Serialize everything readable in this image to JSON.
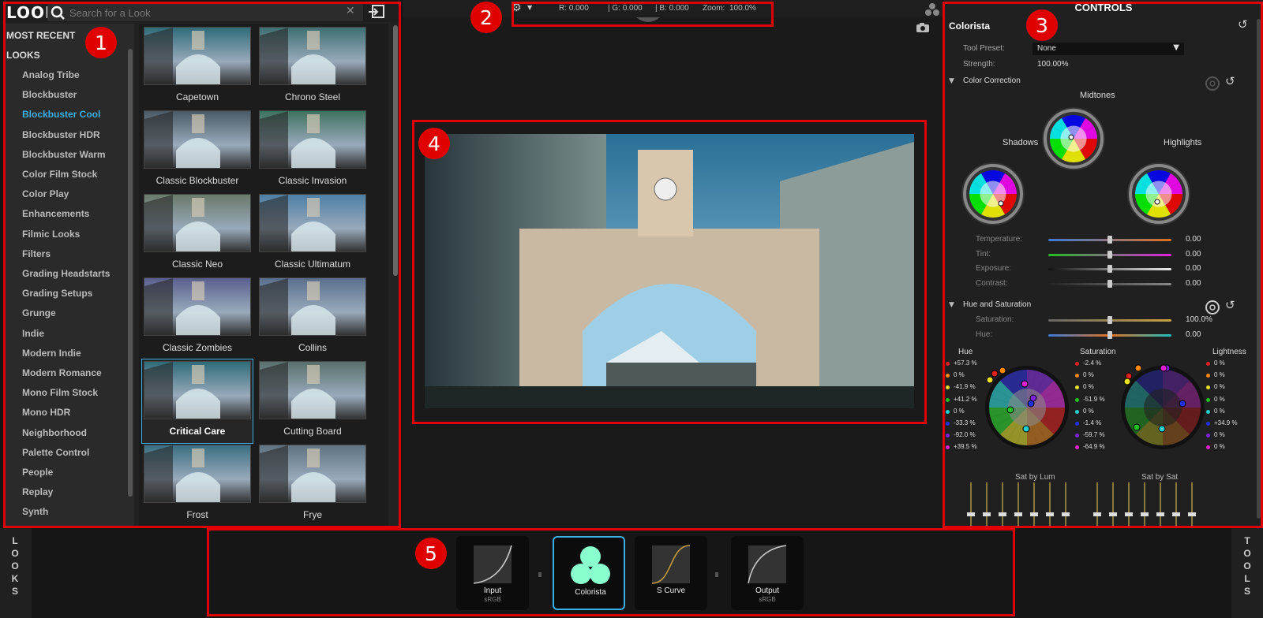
{
  "looks_panel": {
    "logo": "LOOKS",
    "search_placeholder": "Search for a Look",
    "most_recent": "MOST RECENT",
    "looks_header": "LOOKS",
    "categories": [
      "Analog Tribe",
      "Blockbuster",
      "Blockbuster Cool",
      "Blockbuster HDR",
      "Blockbuster Warm",
      "Color Film Stock",
      "Color Play",
      "Enhancements",
      "Filmic Looks",
      "Filters",
      "Grading Headstarts",
      "Grading Setups",
      "Grunge",
      "Indie",
      "Modern Indie",
      "Modern Romance",
      "Mono Film Stock",
      "Mono HDR",
      "Neighborhood",
      "Palette Control",
      "People",
      "Replay",
      "Synth"
    ],
    "selected_category": "Blockbuster Cool",
    "thumbnails": [
      "Capetown",
      "Chrono Steel",
      "Classic Blockbuster",
      "Classic Invasion",
      "Classic Neo",
      "Classic Ultimatum",
      "Classic Zombies",
      "Collins",
      "Critical Care",
      "Cutting Board",
      "Frost",
      "Frye"
    ],
    "selected_thumbnail": "Critical Care"
  },
  "topbar": {
    "r": "R: 0.000",
    "g": "| G: 0.000",
    "b": "| B: 0.000",
    "zoom_label": "Zoom:",
    "zoom_value": "100.0%"
  },
  "controls": {
    "title": "CONTROLS",
    "tool_name": "Colorista",
    "tool_preset_label": "Tool Preset:",
    "tool_preset_value": "None",
    "strength_label": "Strength:",
    "strength_value": "100.00%",
    "color_correction": "Color Correction",
    "midtones": "Midtones",
    "shadows": "Shadows",
    "highlights": "Highlights",
    "sliders": [
      {
        "label": "Temperature:",
        "value": "0.00"
      },
      {
        "label": "Tint:",
        "value": "0.00"
      },
      {
        "label": "Exposure:",
        "value": "0.00"
      },
      {
        "label": "Contrast:",
        "value": "0.00"
      }
    ],
    "hue_sat": "Hue and Saturation",
    "hs_sliders": [
      {
        "label": "Saturation:",
        "value": "100.0%"
      },
      {
        "label": "Hue:",
        "value": "0.00"
      }
    ],
    "hue_header": "Hue",
    "sat_header": "Saturation",
    "light_header": "Lightness",
    "hue_values": [
      "+57.3 %",
      "0 %",
      "-41.9 %",
      "+41.2 %",
      "0 %",
      "-33.3 %",
      "-92.0 %",
      "+39.5 %"
    ],
    "sat_values": [
      "-2.4 %",
      "0 %",
      "0 %",
      "-51.9 %",
      "0 %",
      "-1.4 %",
      "-59.7 %",
      "-64.9 %"
    ],
    "light_values": [
      "0 %",
      "0 %",
      "0 %",
      "0 %",
      "0 %",
      "+34.9 %",
      "0 %",
      "0 %"
    ],
    "dot_colors": [
      "#e02020",
      "#ff8800",
      "#e8e020",
      "#20c020",
      "#20d0d0",
      "#2030e0",
      "#8020e0",
      "#e020d0"
    ],
    "sat_by_lum": "Sat by Lum",
    "sat_by_sat": "Sat by Sat"
  },
  "pipeline": {
    "nodes": [
      {
        "label": "Input",
        "sub": "sRGB"
      },
      {
        "label": "Colorista",
        "sub": ""
      },
      {
        "label": "S Curve",
        "sub": ""
      },
      {
        "label": "Output",
        "sub": "sRGB"
      }
    ],
    "selected": "Colorista"
  },
  "side_tabs": {
    "looks": "LOOKS",
    "tools": "TOOLS"
  },
  "badges": [
    "1",
    "2",
    "3",
    "4",
    "5"
  ],
  "colors": {
    "accent": "#3ab0e8",
    "annotation": "#e00000"
  }
}
